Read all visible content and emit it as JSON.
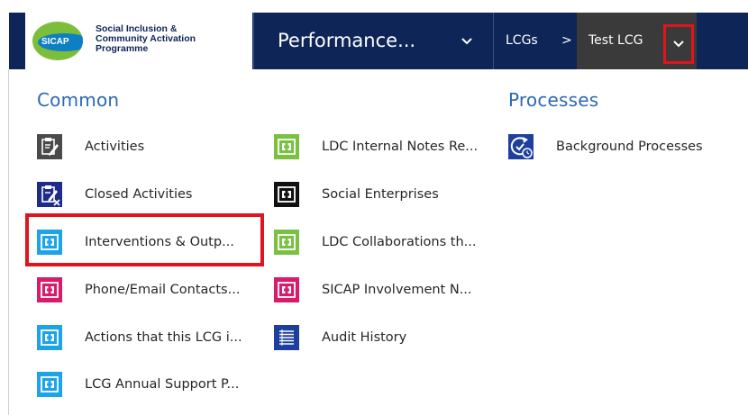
{
  "logo": {
    "badge": "SICAP",
    "text_lines": [
      "Social Inclusion &",
      "Community Activation",
      "Programme"
    ]
  },
  "nav": {
    "area_label": "Performance...",
    "breadcrumbs": [
      "LCGs",
      "Test LCG"
    ],
    "separator": ">",
    "chevron": "⌄"
  },
  "sections": {
    "common_title": "Common",
    "processes_title": "Processes"
  },
  "common_col1": [
    {
      "label": "Activities",
      "icon": "activities-icon"
    },
    {
      "label": "Closed Activities",
      "icon": "closed-activities-icon"
    },
    {
      "label": "Interventions & Outp...",
      "icon": "puzzle-icon"
    },
    {
      "label": "Phone/Email Contacts...",
      "icon": "puzzle-icon"
    },
    {
      "label": "Actions that this LCG i...",
      "icon": "puzzle-icon"
    },
    {
      "label": "LCG Annual Support P...",
      "icon": "puzzle-icon"
    }
  ],
  "common_col2": [
    {
      "label": "LDC Internal Notes Re...",
      "icon": "puzzle-icon"
    },
    {
      "label": "Social Enterprises",
      "icon": "puzzle-icon"
    },
    {
      "label": "LDC Collaborations th...",
      "icon": "puzzle-icon"
    },
    {
      "label": "SICAP Involvement N...",
      "icon": "puzzle-icon"
    },
    {
      "label": "Audit History",
      "icon": "audit-history-icon"
    }
  ],
  "processes": [
    {
      "label": "Background Processes",
      "icon": "background-processes-icon"
    }
  ],
  "colors": {
    "nav_bg": "#0e2557",
    "title_blue": "#2b69b4",
    "highlight_red": "#e0141e",
    "icon_gray": "#4a4a4a",
    "icon_navy": "#1e2b8a",
    "icon_cyan": "#1ea4e6",
    "icon_magenta": "#d81b6a",
    "icon_green": "#7ac143",
    "icon_black": "#111111",
    "icon_blue": "#1d3f9e"
  }
}
